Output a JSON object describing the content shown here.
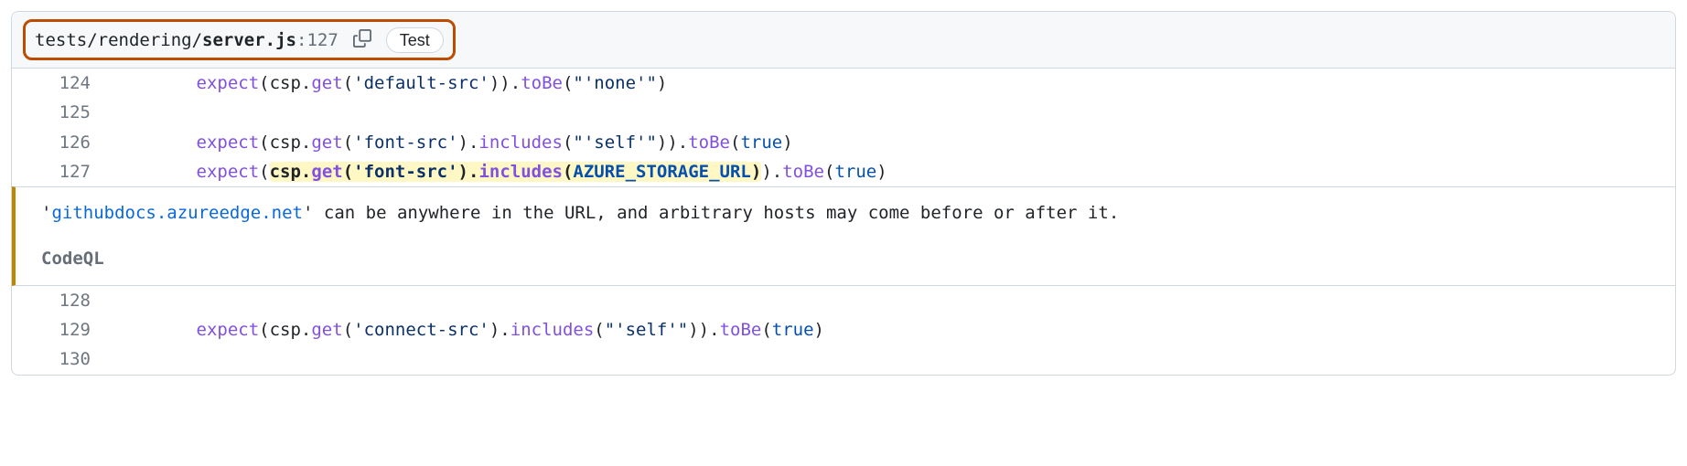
{
  "header": {
    "path_dir": "tests/rendering/",
    "path_file": "server.js",
    "path_colon": ":",
    "path_line": "127",
    "label": "Test"
  },
  "lines": {
    "l124": {
      "num": "124",
      "indent": "        ",
      "t0": "expect",
      "t1": "(csp.",
      "t2": "get",
      "t3": "(",
      "t4": "'default-src'",
      "t5": ")).",
      "t6": "toBe",
      "t7": "(",
      "t8": "\"'none'\"",
      "t9": ")"
    },
    "l125": {
      "num": "125"
    },
    "l126": {
      "num": "126",
      "indent": "        ",
      "t0": "expect",
      "t1": "(csp.",
      "t2": "get",
      "t3": "(",
      "t4": "'font-src'",
      "t5": ").",
      "t6": "includes",
      "t7": "(",
      "t8": "\"'self'\"",
      "t9": ")).",
      "t10": "toBe",
      "t11": "(",
      "t12": "true",
      "t13": ")"
    },
    "l127": {
      "num": "127",
      "indent": "        ",
      "t0": "expect",
      "t1": "(",
      "h0": "csp.",
      "h1": "get",
      "h2": "(",
      "h3": "'font-src'",
      "h4": ").",
      "h5": "includes",
      "h6": "(",
      "h7": "AZURE_STORAGE_URL",
      "h8": ")",
      "t2": ").",
      "t3": "toBe",
      "t4": "(",
      "t5": "true",
      "t6": ")"
    },
    "l128": {
      "num": "128"
    },
    "l129": {
      "num": "129",
      "indent": "        ",
      "t0": "expect",
      "t1": "(csp.",
      "t2": "get",
      "t3": "(",
      "t4": "'connect-src'",
      "t5": ").",
      "t6": "includes",
      "t7": "(",
      "t8": "\"'self'\"",
      "t9": ")).",
      "t10": "toBe",
      "t11": "(",
      "t12": "true",
      "t13": ")"
    },
    "l130": {
      "num": "130"
    }
  },
  "alert": {
    "q0": "'",
    "link": "githubdocs.azureedge.net",
    "q1": "'",
    "rest": " can be anywhere in the URL, and arbitrary hosts may come before or after it.",
    "tool": "CodeQL"
  }
}
